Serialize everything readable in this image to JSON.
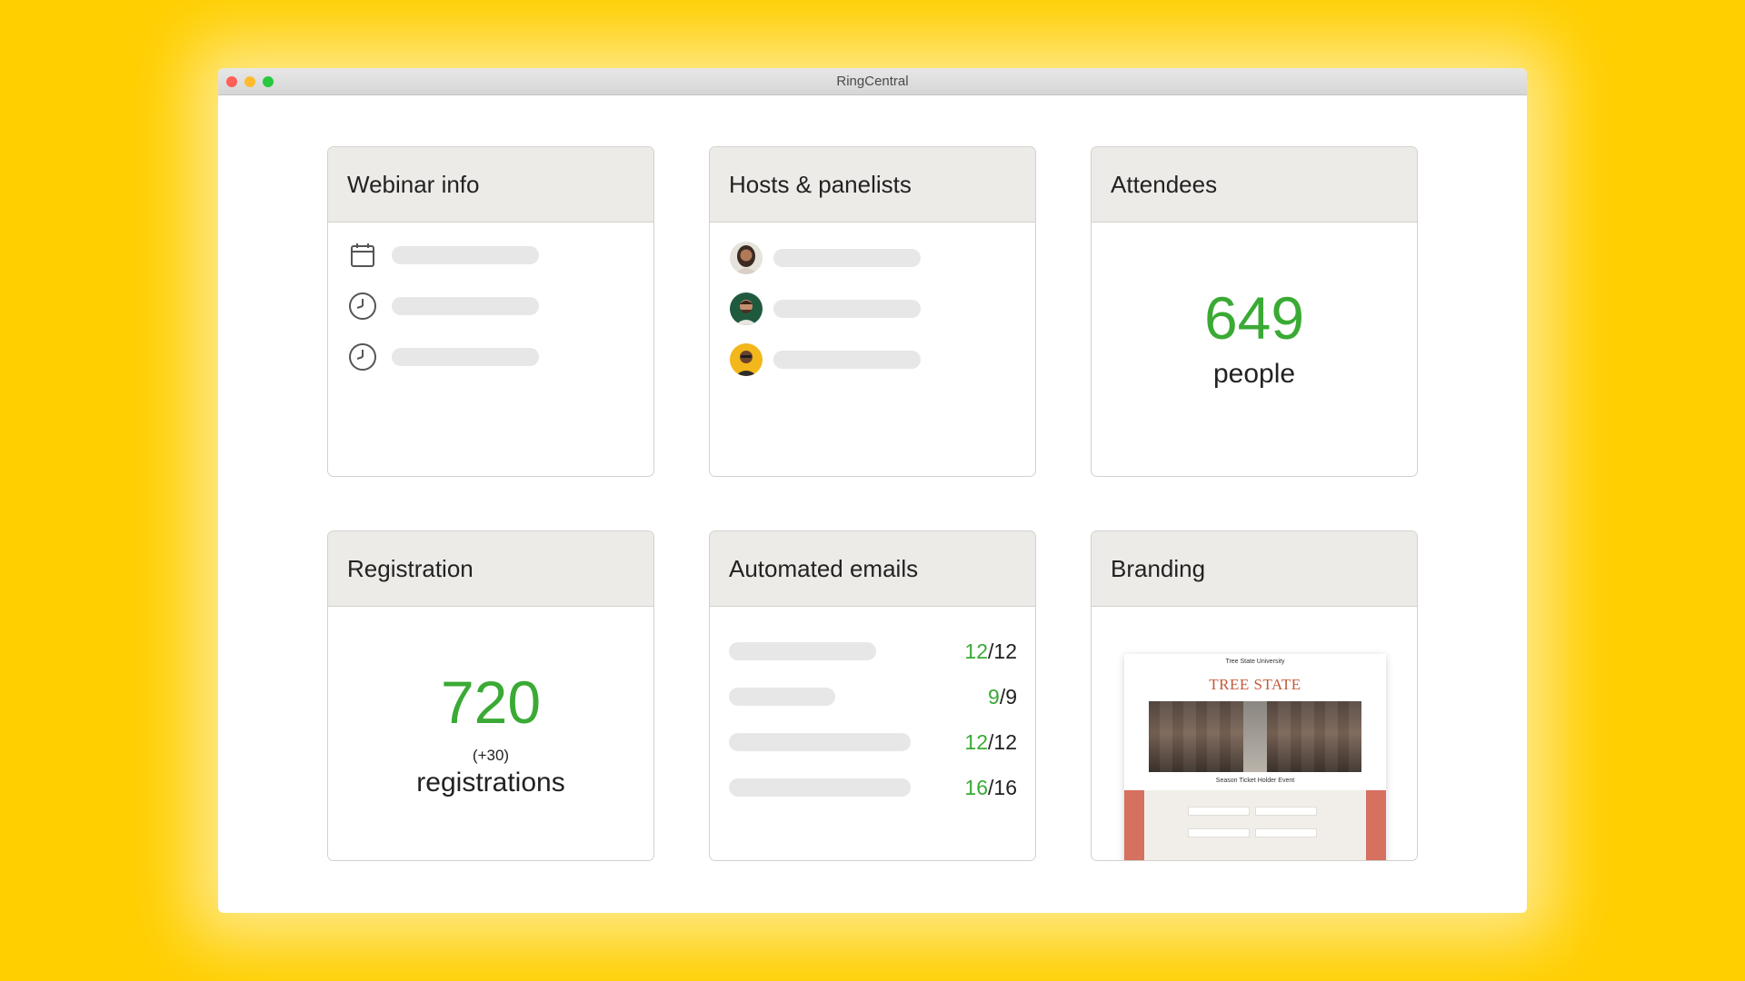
{
  "window": {
    "title": "RingCentral"
  },
  "cards": {
    "webinar_info": {
      "title": "Webinar info"
    },
    "hosts": {
      "title": "Hosts & panelists"
    },
    "attendees": {
      "title": "Attendees",
      "count": "649",
      "unit": "people"
    },
    "registration": {
      "title": "Registration",
      "count": "720",
      "delta": "(+30)",
      "unit": "registrations"
    },
    "emails": {
      "title": "Automated emails",
      "rows": [
        {
          "sent": "12",
          "total": "/12"
        },
        {
          "sent": "9",
          "total": "/9"
        },
        {
          "sent": "12",
          "total": "/12"
        },
        {
          "sent": "16",
          "total": "/16"
        }
      ]
    },
    "branding": {
      "title": "Branding",
      "preview_header": "Tree State University",
      "preview_logo": "TREE STATE",
      "preview_event": "Season Ticket Holder Event"
    }
  },
  "colors": {
    "background": "#FFCF00",
    "accent_green": "#3aaa35",
    "brand_orange": "#c45a3a"
  }
}
